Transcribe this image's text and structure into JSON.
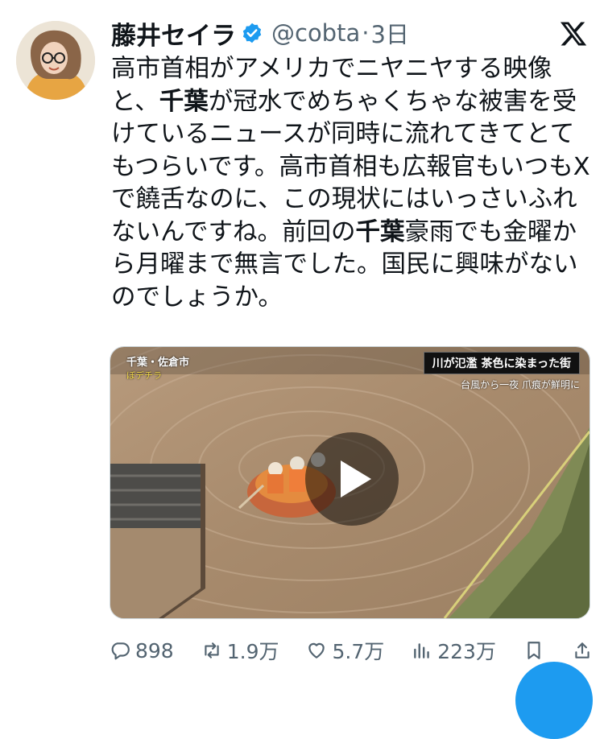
{
  "author": {
    "name": "藤井セイラ",
    "handle": "@cobta",
    "separator": "·",
    "time": "3日",
    "verified_color": "#1d9bf0"
  },
  "tweet": {
    "parts": [
      {
        "text": "高市首相がアメリカでニヤニヤする映像と、",
        "bold": false
      },
      {
        "text": "千葉",
        "bold": true
      },
      {
        "text": "が冠水でめちゃくちゃな被害を受けているニュースが同時に流れてきてとてもつらいです。高市首相も広報官もいつもXで饒舌なのに、この現状にはいっさいふれないんですね。前回の",
        "bold": false
      },
      {
        "text": "千葉",
        "bold": true
      },
      {
        "text": "豪雨でも金曜から月曜まで無言でした。国民に興味がないのでしょうか。",
        "bold": false
      }
    ]
  },
  "media": {
    "location_label": "千葉・佐倉市",
    "location_sub": "ぼデチラ",
    "headline": "川が氾濫 茶色に染まった街",
    "subheadline": "台風から一夜 爪痕が鮮明に",
    "play_icon": "play-icon"
  },
  "actions": {
    "replies": "898",
    "retweets": "1.9万",
    "likes": "5.7万",
    "views": "223万"
  },
  "colors": {
    "accent": "#1d9bf0",
    "muted": "#536471",
    "text": "#0f1419"
  }
}
